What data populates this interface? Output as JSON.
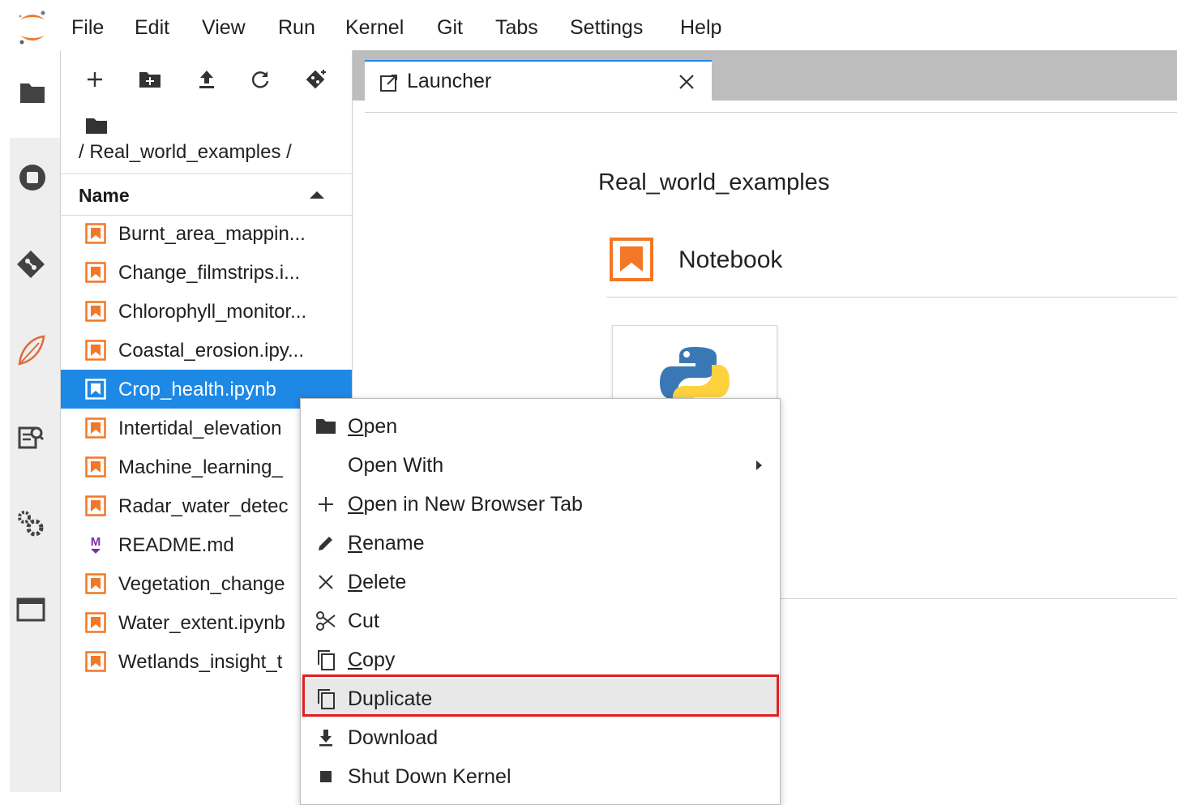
{
  "menubar": {
    "items": [
      "File",
      "Edit",
      "View",
      "Run",
      "Kernel",
      "Git",
      "Tabs",
      "Settings",
      "Help"
    ]
  },
  "filebrowser": {
    "breadcrumb": "/ Real_world_examples /",
    "column_header": "Name",
    "files": [
      {
        "name": "Burnt_area_mappin...",
        "type": "notebook"
      },
      {
        "name": "Change_filmstrips.i...",
        "type": "notebook"
      },
      {
        "name": "Chlorophyll_monitor...",
        "type": "notebook"
      },
      {
        "name": "Coastal_erosion.ipy...",
        "type": "notebook"
      },
      {
        "name": "Crop_health.ipynb",
        "type": "notebook",
        "selected": true
      },
      {
        "name": "Intertidal_elevation",
        "type": "notebook"
      },
      {
        "name": "Machine_learning_",
        "type": "notebook"
      },
      {
        "name": "Radar_water_detec",
        "type": "notebook"
      },
      {
        "name": "README.md",
        "type": "markdown"
      },
      {
        "name": "Vegetation_change",
        "type": "notebook"
      },
      {
        "name": "Water_extent.ipynb",
        "type": "notebook"
      },
      {
        "name": "Wetlands_insight_t",
        "type": "notebook"
      }
    ]
  },
  "tabs": [
    {
      "label": "Launcher",
      "active": true
    }
  ],
  "launcher": {
    "title": "Real_world_examples",
    "section_label": "Notebook"
  },
  "context_menu": {
    "items": [
      {
        "label": "Open",
        "mnemonic": "O",
        "icon": "folder-icon"
      },
      {
        "label": "Open With",
        "mnemonic": "",
        "icon": "",
        "submenu": true
      },
      {
        "label": "Open in New Browser Tab",
        "mnemonic": "O",
        "icon": "plus-icon"
      },
      {
        "label": "Rename",
        "mnemonic": "R",
        "icon": "pencil-icon"
      },
      {
        "label": "Delete",
        "mnemonic": "D",
        "icon": "x-icon"
      },
      {
        "label": "Cut",
        "mnemonic": "",
        "icon": "scissors-icon"
      },
      {
        "label": "Copy",
        "mnemonic": "C",
        "icon": "copy-icon"
      },
      {
        "label": "Duplicate",
        "mnemonic": "",
        "icon": "duplicate-icon",
        "active": true
      },
      {
        "label": "Download",
        "mnemonic": "",
        "icon": "download-icon"
      },
      {
        "label": "Shut Down Kernel",
        "mnemonic": "",
        "icon": "stop-icon"
      }
    ]
  },
  "colors": {
    "accent": "#1e88e5",
    "notebook_orange": "#f37726",
    "markdown_purple": "#7b2fa8",
    "highlight_red": "#e02020"
  }
}
